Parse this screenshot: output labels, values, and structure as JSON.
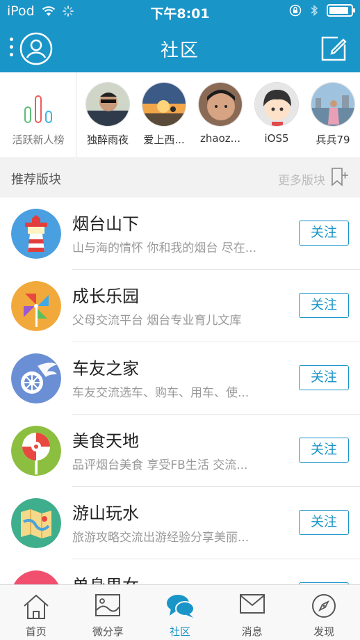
{
  "status_bar": {
    "carrier": "iPod",
    "time": "下午8:01",
    "battery_level": 0.9
  },
  "nav": {
    "title": "社区"
  },
  "active_users": {
    "rank_label": "活跃新人榜",
    "users": [
      {
        "name": "独醉雨夜"
      },
      {
        "name": "爱上西..."
      },
      {
        "name": "zhaoz..."
      },
      {
        "name": "iOS5"
      },
      {
        "name": "兵兵79"
      }
    ]
  },
  "section": {
    "title": "推荐版块",
    "more_label": "更多版块"
  },
  "boards": [
    {
      "name": "烟台山下",
      "desc": "山与海的情怀 你和我的烟台 尽在...",
      "follow": "关注",
      "icon": "lighthouse-icon"
    },
    {
      "name": "成长乐园",
      "desc": "父母交流平台 烟台专业育儿文库",
      "follow": "关注",
      "icon": "pinwheel-icon"
    },
    {
      "name": "车友之家",
      "desc": "车友交流选车、购车、用车、使...",
      "follow": "关注",
      "icon": "car-wheel-icon"
    },
    {
      "name": "美食天地",
      "desc": "品评烟台美食 享受FB生活 交流...",
      "follow": "关注",
      "icon": "lollipop-icon"
    },
    {
      "name": "游山玩水",
      "desc": "旅游攻略交流出游经验分享美丽...",
      "follow": "关注",
      "icon": "map-icon"
    },
    {
      "name": "单身男女",
      "desc": "",
      "follow": "关注",
      "icon": "heart-icon"
    }
  ],
  "tabs": [
    {
      "label": "首页",
      "icon": "home-icon"
    },
    {
      "label": "微分享",
      "icon": "image-icon"
    },
    {
      "label": "社区",
      "icon": "chat-bubbles-icon",
      "active": true
    },
    {
      "label": "消息",
      "icon": "envelope-icon"
    },
    {
      "label": "发现",
      "icon": "compass-icon"
    }
  ],
  "colors": {
    "accent": "#1a95c8",
    "header_bg": "#1a95c8",
    "tabbar_bg": "#f8f8f8"
  }
}
